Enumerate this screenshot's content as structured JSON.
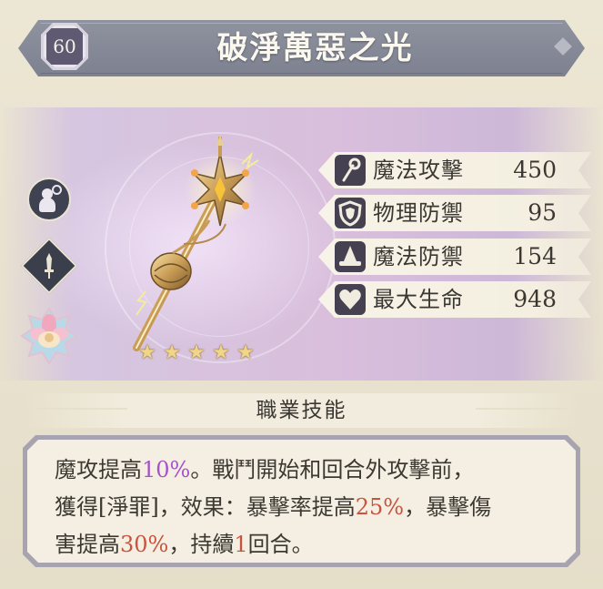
{
  "header": {
    "level": "60",
    "title": "破淨萬惡之光"
  },
  "stats": [
    {
      "icon": "magic-attack-icon",
      "label": "魔法攻擊",
      "value": "450"
    },
    {
      "icon": "physical-defense-icon",
      "label": "物理防禦",
      "value": "95"
    },
    {
      "icon": "magic-defense-icon",
      "label": "魔法防禦",
      "value": "154"
    },
    {
      "icon": "max-hp-icon",
      "label": "最大生命",
      "value": "948"
    }
  ],
  "rarity_stars": 5,
  "skill": {
    "header": "職業技能",
    "line1": {
      "a": "魔攻提高",
      "b": "10%",
      "c": "。戰鬥開始和回合外攻擊前，"
    },
    "line2": {
      "a": "獲得[淨罪]，效果：暴擊率提高",
      "b": "25%",
      "c": "，暴擊傷"
    },
    "line3": {
      "a": "害提高",
      "b": "30%",
      "c": "，持續",
      "d": "1",
      "e": "回合。"
    }
  },
  "colors": {
    "highlight_purple": "#a553c9",
    "highlight_red": "#c9543e",
    "title_bar": "#868a97"
  },
  "icons": {
    "left_top": "character-search-icon",
    "left_middle": "sword-class-icon",
    "left_bottom": "lotus-class-icon"
  }
}
